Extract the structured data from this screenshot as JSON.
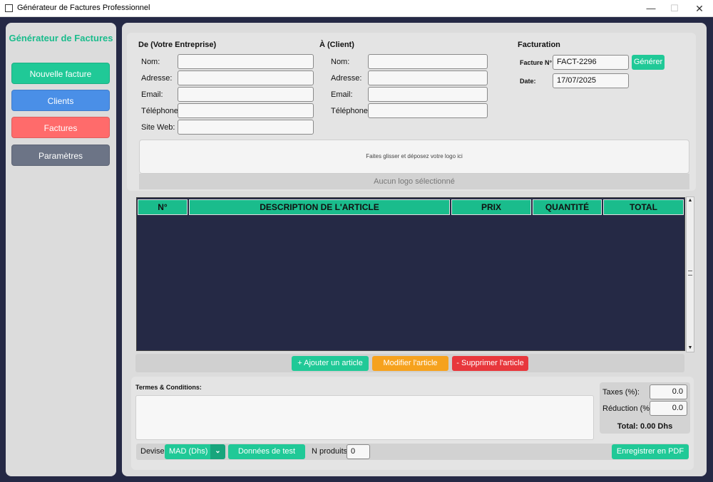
{
  "window": {
    "title": "Générateur de Factures Professionnel",
    "minimize": "—",
    "maximize": "☐",
    "close": "✕"
  },
  "colors": {
    "accent": "#1abc8c",
    "blue": "#4a8fe7",
    "red": "#ff6b6b",
    "gray": "#6c7486",
    "orange": "#f6a21e",
    "danger": "#e8373c",
    "dark": "#252945"
  },
  "sidebar": {
    "title": "Générateur de Factures",
    "items": [
      {
        "label": "Nouvelle facture",
        "color": "#20c997"
      },
      {
        "label": "Clients",
        "color": "#4a8fe7"
      },
      {
        "label": "Factures",
        "color": "#ff6b6b"
      },
      {
        "label": "Paramètres",
        "color": "#6c7486"
      }
    ]
  },
  "from": {
    "title": "De (Votre Entreprise)",
    "name_label": "Nom:",
    "name_value": "",
    "address_label": "Adresse:",
    "address_value": "",
    "email_label": "Email:",
    "email_value": "",
    "phone_label": "Téléphone:",
    "phone_value": "",
    "website_label": "Site Web:",
    "website_value": ""
  },
  "to": {
    "title": "À (Client)",
    "name_label": "Nom:",
    "name_value": "",
    "address_label": "Adresse:",
    "address_value": "",
    "email_label": "Email:",
    "email_value": "",
    "phone_label": "Téléphone:",
    "phone_value": ""
  },
  "billing": {
    "title": "Facturation",
    "invoice_label": "Facture N°:",
    "invoice_value": "FACT-2296",
    "generate_label": "Générer",
    "date_label": "Date:",
    "date_value": "17/07/2025"
  },
  "logo": {
    "drop_text": "Faites glisser et déposez votre logo ici",
    "status": "Aucun logo sélectionné"
  },
  "table": {
    "columns": [
      "N°",
      "DESCRIPTION DE L'ARTICLE",
      "PRIX",
      "QUANTITÉ",
      "TOTAL"
    ],
    "rows": []
  },
  "actions": {
    "add": "+ Ajouter un article",
    "edit": "Modifier l'article",
    "delete": "- Supprimer l'article"
  },
  "terms": {
    "label": "Termes & Conditions:",
    "value": ""
  },
  "totals": {
    "tax_label": "Taxes (%):",
    "tax_value": "0.0",
    "discount_label": "Réduction (%):",
    "discount_value": "0.0",
    "total": "Total: 0.00 Dhs"
  },
  "footer": {
    "currency_label": "Devise:",
    "currency_value": "MAD (Dhs)",
    "test_data": "Données de test",
    "products_label": "N produits:",
    "products_value": "0",
    "save_pdf": "Enregistrer en PDF"
  }
}
